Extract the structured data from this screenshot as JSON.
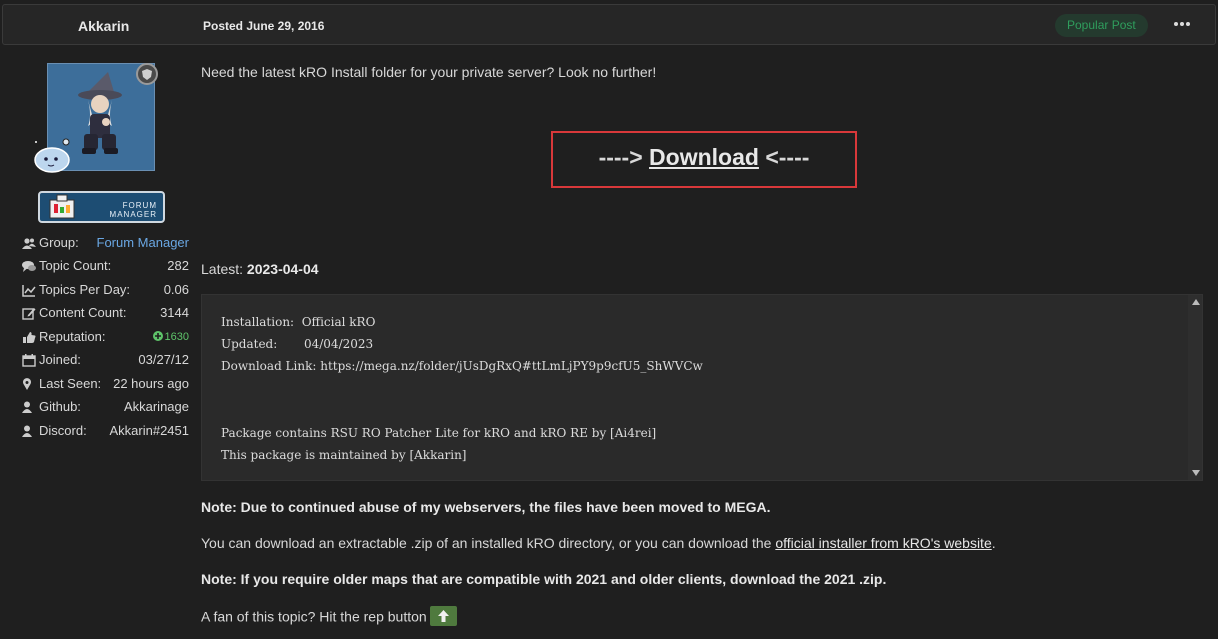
{
  "header": {
    "author": "Akkarin",
    "posted": "Posted June 29, 2016",
    "popular": "Popular Post",
    "menu_icon": "ellipsis-icon"
  },
  "badge": {
    "line1": "FORUM",
    "line2": "MANAGER"
  },
  "profile": [
    {
      "icon": "users-icon",
      "label": "Group:",
      "value": "Forum Manager"
    },
    {
      "icon": "comments-icon",
      "label": "Topic Count:",
      "value": "282"
    },
    {
      "icon": "line-chart-icon",
      "label": "Topics Per Day:",
      "value": "0.06"
    },
    {
      "icon": "edit-icon",
      "label": "Content Count:",
      "value": "3144"
    },
    {
      "icon": "thumbs-up-icon",
      "label": "Reputation:",
      "value": "1630"
    },
    {
      "icon": "calendar-icon",
      "label": "Joined:",
      "value": "03/27/12"
    },
    {
      "icon": "map-marker-icon",
      "label": "Last Seen:",
      "value": "22 hours ago"
    },
    {
      "icon": "user-icon",
      "label": "Github:",
      "value": "Akkarinage"
    },
    {
      "icon": "user-icon",
      "label": "Discord:",
      "value": "Akkarin#2451"
    }
  ],
  "post": {
    "intro": "Need the latest kRO Install folder for your private server? Look no further!",
    "download_prefix": "----> ",
    "download_link": "Download",
    "download_suffix": " <----",
    "latest_label": "Latest: ",
    "latest_value": "2023-04-04",
    "code_lines": [
      "Installation:  Official kRO",
      "Updated:       04/04/2023",
      "Download Link: https://mega.nz/folder/jUsDgRxQ#ttLmLjPY9p9cfU5_ShWVCw",
      "Package contains RSU RO Patcher Lite for kRO and kRO RE by [Ai4rei]",
      "This package is maintained by [Akkarin]"
    ],
    "note1": "Note: Due to continued abuse of my webservers, the files have been moved to MEGA.",
    "para2_before": "You can download an extractable .zip of an installed kRO directory, or you can download the ",
    "para2_link": "official installer from kRO's website",
    "para2_after": ".",
    "note2": "Note: If you require older maps that are compatible with 2021 and older clients, download the 2021 .zip.",
    "fan_text": "A fan of this topic? Hit the rep button"
  }
}
